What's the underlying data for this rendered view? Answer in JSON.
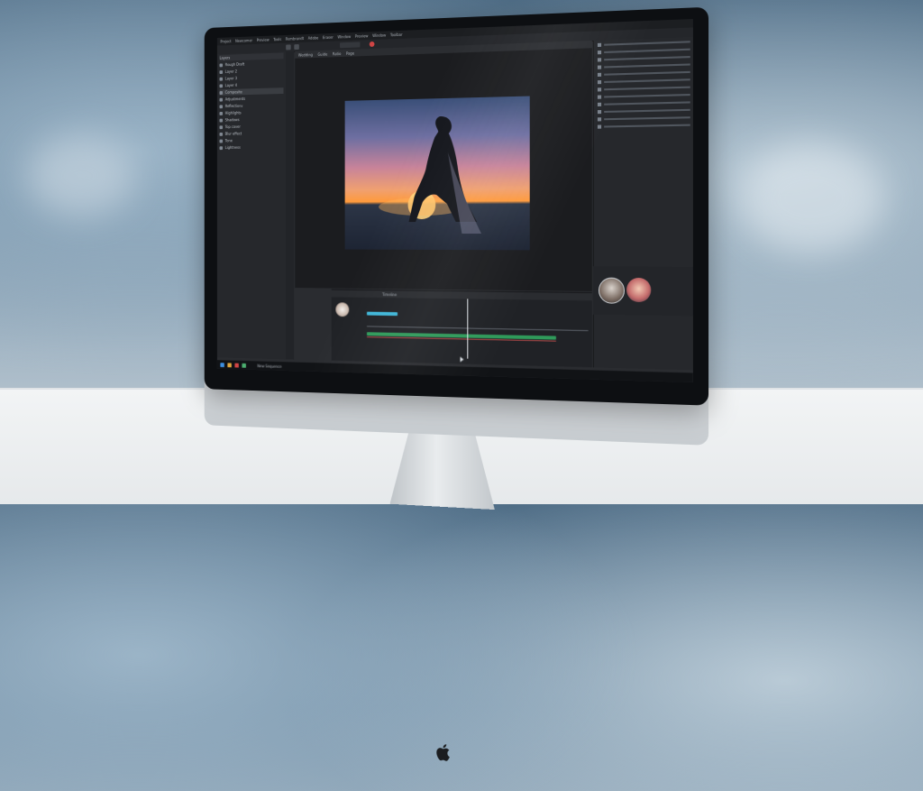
{
  "menubar": {
    "items": [
      "Project",
      "Newcomer",
      "Preview",
      "Tools",
      "Rembrandt",
      "Adobe",
      "Eraser",
      "Window",
      "Preview",
      "Window",
      "Toolbar"
    ]
  },
  "canvas": {
    "tabs": [
      "Wedding",
      "Guide",
      "Ratio",
      "Page"
    ]
  },
  "left_panel": {
    "header": "Layers",
    "items": [
      "Rough Draft",
      "Layer 2",
      "Layer 3",
      "Layer 4",
      "Composite",
      "Adjustments",
      "Reflections",
      "Highlights",
      "Shadows",
      "Top cover",
      "Blur effect",
      "Tone",
      "Lightness"
    ]
  },
  "timeline": {
    "label": "Timeline"
  },
  "taskbar": {
    "status": "New Sequence"
  },
  "colors": {
    "accent": "#3fb6d8",
    "track_green": "#2f9a5a",
    "panel": "#26282c",
    "background": "#1b1c1f"
  }
}
